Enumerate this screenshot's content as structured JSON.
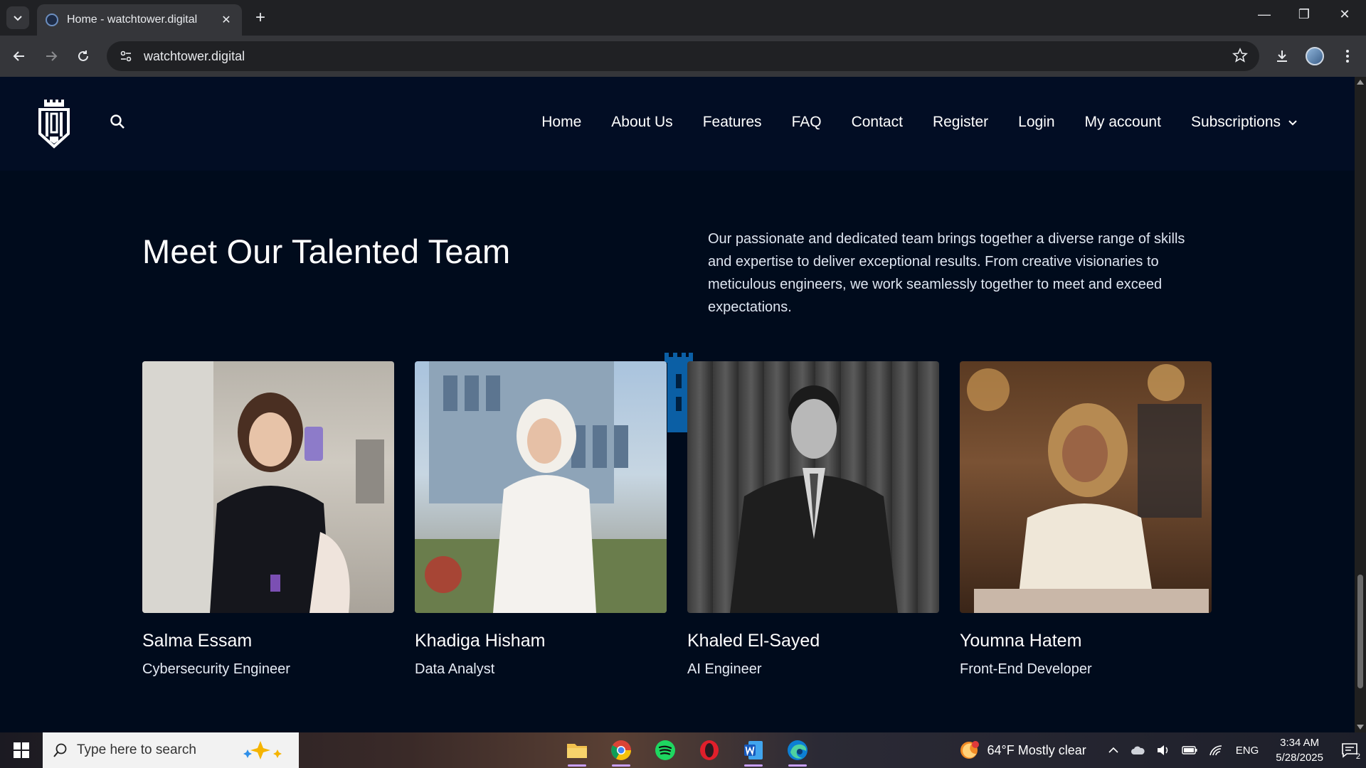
{
  "browser": {
    "tab_title": "Home - watchtower.digital",
    "url": "watchtower.digital"
  },
  "nav": {
    "items": [
      "Home",
      "About Us",
      "Features",
      "FAQ",
      "Contact",
      "Register",
      "Login",
      "My account",
      "Subscriptions"
    ]
  },
  "section": {
    "title": "Meet Our Talented Team",
    "description": "Our passionate and dedicated team brings together a diverse range of skills and expertise to deliver exceptional results. From creative visionaries to meticulous engineers, we work seamlessly together to meet and exceed expectations."
  },
  "team": [
    {
      "name": "Salma Essam",
      "role": "Cybersecurity Engineer"
    },
    {
      "name": "Khadiga Hisham",
      "role": "Data Analyst"
    },
    {
      "name": "Khaled El-Sayed",
      "role": "AI Engineer"
    },
    {
      "name": "Youmna Hatem",
      "role": "Front-End Developer"
    }
  ],
  "taskbar": {
    "search_placeholder": "Type here to search",
    "weather": "64°F  Mostly clear",
    "language": "ENG",
    "time": "3:34 AM",
    "date": "5/28/2025",
    "notifications": "2"
  },
  "colors": {
    "page_bg": "#000b1c",
    "header_bg": "#020d24",
    "accent": "#0b5fa5"
  }
}
